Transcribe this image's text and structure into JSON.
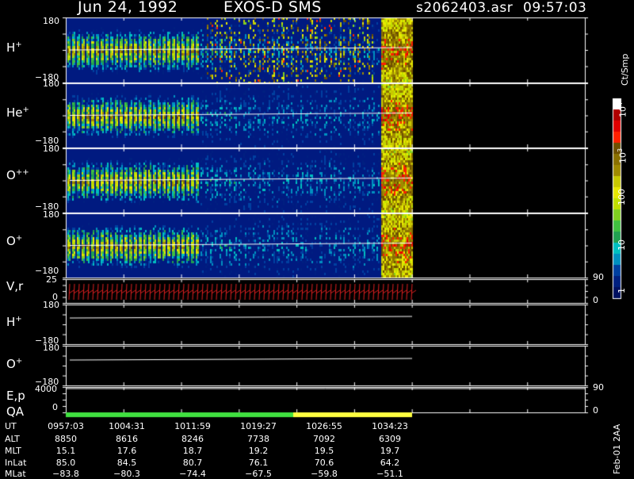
{
  "header": {
    "date": "Jun 24, 1992",
    "instrument": "EXOS-D SMS",
    "file": "s2062403.asr",
    "time": "09:57:03"
  },
  "panels": [
    {
      "species": "H",
      "charge": "+",
      "ymax": "180",
      "ymin": "−180"
    },
    {
      "species": "He",
      "charge": "+",
      "ymax": "180",
      "ymin": "−180"
    },
    {
      "species": "O",
      "charge": "++",
      "ymax": "180",
      "ymin": "−180"
    },
    {
      "species": "O",
      "charge": "+",
      "ymax": "180",
      "ymin": "−180"
    }
  ],
  "vr_panel": {
    "label": "V,r",
    "ytop": "25",
    "ybottom": "0",
    "right_top": "90",
    "right_bottom": "0"
  },
  "line_panels": [
    {
      "species": "H",
      "charge": "+",
      "ymax": "180",
      "ymin": "−180"
    },
    {
      "species": "O",
      "charge": "+",
      "ymax": "180",
      "ymin": "−180"
    }
  ],
  "ep_panel": {
    "label": "E,p",
    "ytop": "4000",
    "ybottom": "0",
    "right_top": "90",
    "right_bottom": "0"
  },
  "qa_label": "QA",
  "colorbar": {
    "unit": "Ct/Smp",
    "ticks": [
      "10",
      "10",
      "100",
      "10",
      "1"
    ],
    "exps": [
      "4",
      "3",
      "",
      "",
      ""
    ],
    "colors": [
      "#ffffff",
      "#b00000",
      "#e00000",
      "#ff2000",
      "#6e5000",
      "#8a7000",
      "#a08a00",
      "#c8c800",
      "#e8e800",
      "#c0e000",
      "#80d020",
      "#40c040",
      "#20a050",
      "#00c0c0",
      "#0090c0",
      "#0040a0",
      "#002080",
      "#001060"
    ]
  },
  "side_note": "Feb-01 2AA",
  "qa": {
    "green_until": "1026:55",
    "colors": {
      "good": "#40e040",
      "warn": "#ffff40"
    }
  },
  "ephemeris": {
    "row_labels": [
      "UT",
      "ALT",
      "MLT",
      "InLat",
      "MLat"
    ],
    "columns": [
      [
        "0957:03",
        "8850",
        "15.1",
        "85.0",
        "−83.8"
      ],
      [
        "1004:31",
        "8616",
        "17.6",
        "84.5",
        "−80.3"
      ],
      [
        "1011:59",
        "8246",
        "18.7",
        "80.7",
        "−74.4"
      ],
      [
        "1019:27",
        "7738",
        "19.2",
        "76.1",
        "−67.5"
      ],
      [
        "1026:55",
        "7092",
        "19.5",
        "70.6",
        "−59.8"
      ],
      [
        "1034:23",
        "6309",
        "19.7",
        "64.2",
        "−51.1"
      ]
    ]
  },
  "chart_data": {
    "type": "heatmap",
    "x_ticks_ut": [
      "0957:03",
      "1004:31",
      "1011:59",
      "1019:27",
      "1026:55",
      "1034:23"
    ],
    "y_range_pitch_angle": [
      -180,
      180
    ],
    "color_scale": "log",
    "color_range": [
      1,
      10000
    ],
    "data_end_ut": "1036:40"
  }
}
